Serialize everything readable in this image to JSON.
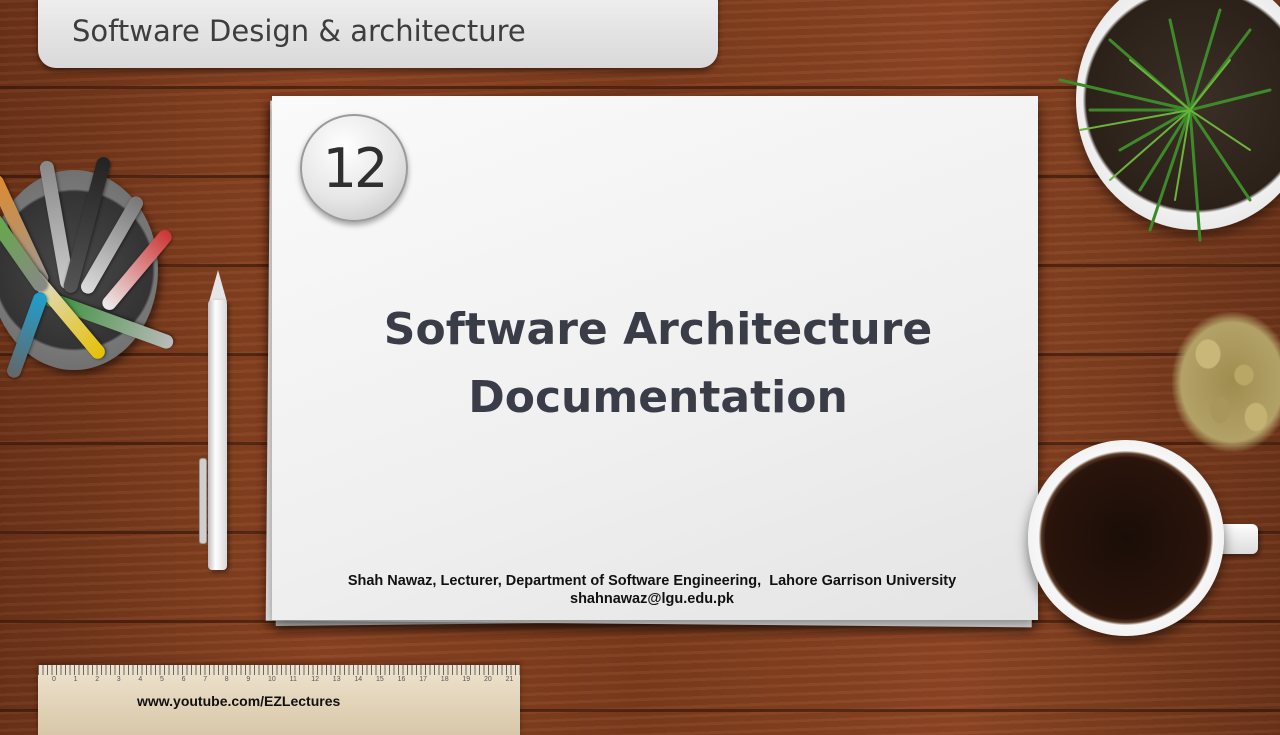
{
  "header": {
    "course_title": "Software Design & architecture"
  },
  "slide": {
    "lecture_number": "12",
    "title_line1": "Software Architecture",
    "title_line2": "Documentation",
    "author_line": "Shah Nawaz, Lecturer, Department of Software Engineering,  Lahore Garrison University",
    "email": "shahnawaz@lgu.edu.pk"
  },
  "ruler": {
    "numbers": [
      "0",
      "1",
      "2",
      "3",
      "4",
      "5",
      "6",
      "7",
      "8",
      "9",
      "10",
      "11",
      "12",
      "13",
      "14",
      "15",
      "16",
      "17",
      "18",
      "19",
      "20",
      "21"
    ]
  },
  "footer": {
    "channel_url": "www.youtube.com/EZLectures"
  },
  "colors": {
    "desk_wood": "#7b3a1c",
    "paper": "#f2f2f2",
    "title_text": "#3a3d48"
  },
  "icons": [
    "pen-cup-icon",
    "pencil-icon",
    "plant-pot-icon",
    "seeds-icon",
    "coffee-cup-icon",
    "ruler-icon"
  ]
}
